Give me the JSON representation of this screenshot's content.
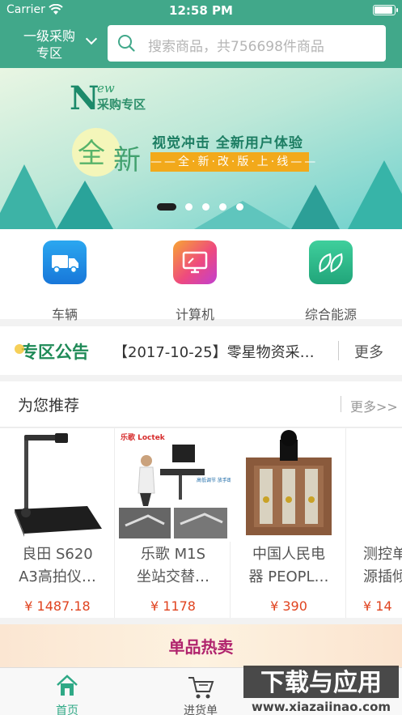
{
  "status_bar": {
    "carrier": "Carrier",
    "time": "12:58 PM"
  },
  "header": {
    "region_line1": "一级采购",
    "region_line2": "专区",
    "search_placeholder": "搜索商品，共756698件商品"
  },
  "banner": {
    "logo_n": "N",
    "logo_ew": "ew",
    "logo_sub": "采购专区",
    "big_1": "全",
    "big_2": "新",
    "slogan": "视觉冲击 全新用户体验",
    "tagline": "——全·新·改·版·上·线——",
    "slide_count": 5,
    "active_slide": 1
  },
  "categories": [
    {
      "label": "车辆",
      "icon": "truck-icon",
      "color": "#1b8fe3"
    },
    {
      "label": "计算机",
      "icon": "monitor-icon",
      "color": "#ee4a7e"
    },
    {
      "label": "综合能源",
      "icon": "leaf-icon",
      "color": "#2fb889"
    }
  ],
  "notice": {
    "tag": "专区公告",
    "text": "【2017-10-25】零星物资采…",
    "more": "更多"
  },
  "recommend": {
    "title": "为您推荐",
    "more": "更多>>",
    "products": [
      {
        "line1": "良田 S620",
        "line2": "A3高拍仪…",
        "price": "¥ 1487.18"
      },
      {
        "line1": "乐歌 M1S",
        "line2": "坐站交替…",
        "price": "¥ 1178",
        "img_brand": "乐歌 Loctek",
        "img_note": "高低调节 放手即停"
      },
      {
        "line1": "中国人民电",
        "line2": "器 PEOPL…",
        "price": "¥ 390"
      },
      {
        "line1": "测控单",
        "line2": "源插倾",
        "price": "¥ 14"
      }
    ]
  },
  "hot": {
    "title": "单品热卖"
  },
  "tabbar": {
    "tabs": [
      {
        "label": "首页",
        "icon": "home-icon",
        "active": true
      },
      {
        "label": "进货单",
        "icon": "cart-icon",
        "active": false
      }
    ]
  },
  "watermark": {
    "line1": "下载与应用",
    "line2": "www.xiazaiinao.com"
  },
  "colors": {
    "brand": "#41a88a",
    "price": "#e0431f",
    "hot_title": "#b0236d",
    "active_tab": "#2fa986"
  }
}
